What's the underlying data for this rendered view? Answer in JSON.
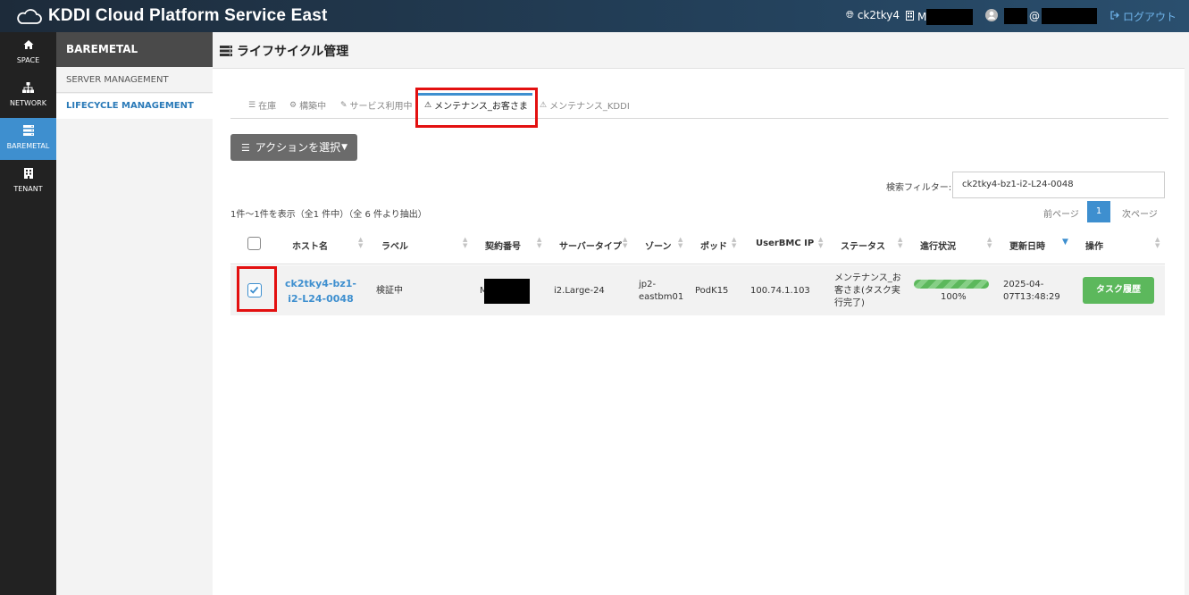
{
  "header": {
    "title": "KDDI Cloud Platform Service East",
    "space_name": "ck2tky4",
    "org_prefix": "M",
    "user_suffix": "@",
    "logout_label": "ログアウト"
  },
  "leftnav": [
    {
      "label": "SPACE",
      "icon": "home-icon"
    },
    {
      "label": "NETWORK",
      "icon": "network-icon"
    },
    {
      "label": "BAREMETAL",
      "icon": "server-icon",
      "active": true
    },
    {
      "label": "TENANT",
      "icon": "building-icon"
    }
  ],
  "subnav": {
    "heading": "BAREMETAL",
    "items": [
      {
        "label": "SERVER MANAGEMENT"
      },
      {
        "label": "LIFECYCLE MANAGEMENT",
        "active": true
      }
    ]
  },
  "page": {
    "title": "ライフサイクル管理"
  },
  "tabs": [
    {
      "label": "在庫",
      "icon": "list-icon"
    },
    {
      "label": "構築中",
      "icon": "gears-icon"
    },
    {
      "label": "サービス利用中",
      "icon": "rocket-icon"
    },
    {
      "label": "メンテナンス_お客さま",
      "icon": "warning-icon",
      "active": true
    },
    {
      "label": "メンテナンス_KDDI",
      "icon": "warning-icon"
    }
  ],
  "action_button": {
    "label": "アクションを選択"
  },
  "filter": {
    "label": "検索フィルター:",
    "value": "ck2tky4-bz1-i2-L24-0048"
  },
  "summary": "1件〜1件を表示（全1 件中）（全 6 件より抽出）",
  "pager": {
    "prev": "前ページ",
    "current": "1",
    "next": "次ページ"
  },
  "table": {
    "columns": [
      "ホスト名",
      "ラベル",
      "契約番号",
      "サーバータイプ",
      "ゾーン",
      "ポッド",
      "UserBMC IP",
      "ステータス",
      "進行状況",
      "更新日時",
      "操作"
    ],
    "rows": [
      {
        "checked": true,
        "host_line1": "ck2tky4-bz1-",
        "host_line2": "i2-L24-0048",
        "label": "検証中",
        "contract_prefix": "M",
        "server_type": "i2.Large-24",
        "zone_line1": "jp2-",
        "zone_line2": "eastbm01",
        "pod": "PodK15",
        "bmc_ip": "100.74.1.103",
        "status_line1": "メンテナンス_お",
        "status_line2": "客さま(タスク実",
        "status_line3": "行完了)",
        "progress_percent": 100,
        "progress_label": "100%",
        "updated_line1": "2025-04-",
        "updated_line2": "07T13:48:29",
        "action_label": "タスク履歴"
      }
    ]
  },
  "colors": {
    "accent": "#3e8fcf",
    "success": "#5cb85c",
    "highlight": "#e31010"
  }
}
